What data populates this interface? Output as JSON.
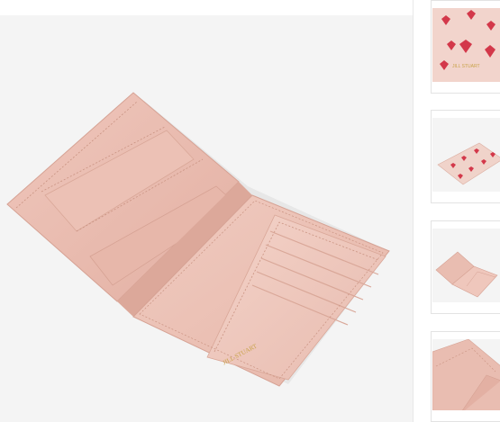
{
  "product": {
    "brand_stamp": "JILL STUART",
    "colors": {
      "leather": "#e9bdb1",
      "leather_shadow": "#d9a597",
      "stitch": "#c99382",
      "foil": "#c9a34a",
      "heart": "#d3384a",
      "heart_dark": "#9f1f2f",
      "background": "#f4f4f4"
    }
  },
  "thumbnails": [
    {
      "label": "",
      "icon": "heart-pattern-closeup"
    },
    {
      "label": "",
      "icon": "heart-pattern-closed-case"
    },
    {
      "label": "",
      "icon": "open-passport-case"
    },
    {
      "label": "",
      "icon": "inner-pocket-closeup"
    }
  ]
}
